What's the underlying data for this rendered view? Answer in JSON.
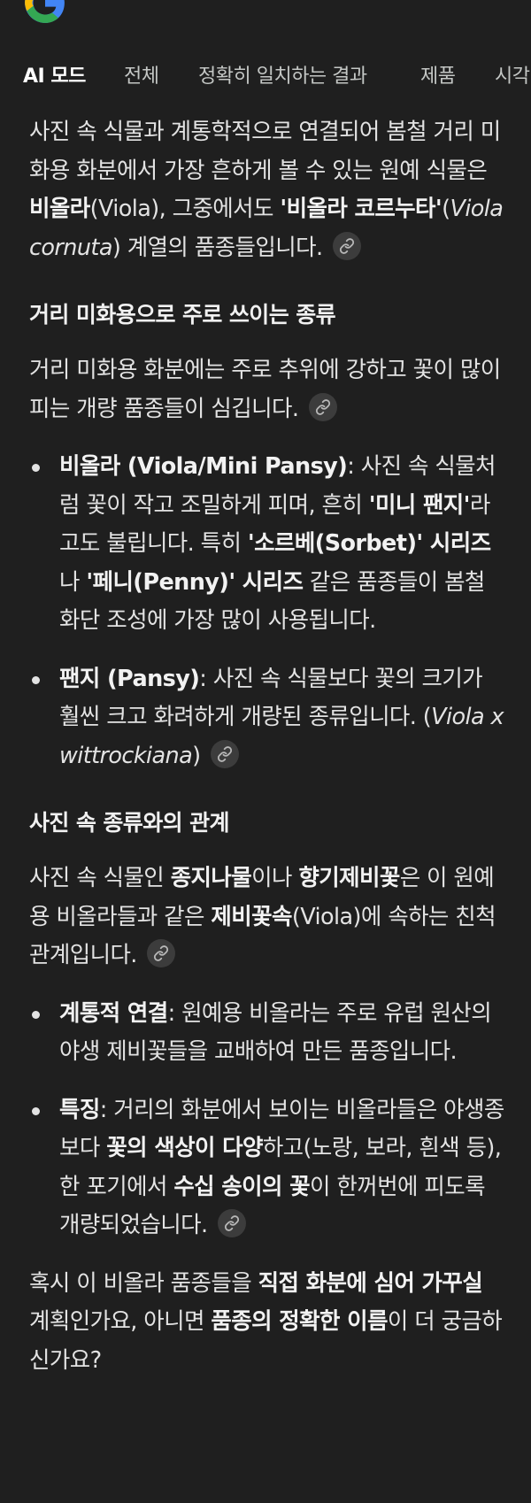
{
  "tabs": [
    "AI 모드",
    "전체",
    "정확히 일치하는 결과",
    "제품",
    "시각"
  ],
  "intro": {
    "t1": "사진 속 식물과 계통학적으로 연결되어 봄철 거리 미화용 화분에서 가장 흔하게 볼 수 있는 원예 식물은 ",
    "b1": "비올라",
    "t2": "(Viola), 그중에서도 ",
    "b2": "'비올라 코르누타'",
    "t3": "(",
    "i1": "Viola cornuta",
    "t4": ") 계열의 품종들입니다."
  },
  "section1": {
    "heading": "거리 미화용으로 주로 쓰이는 종류",
    "para": "거리 미화용 화분에는 주로 추위에 강하고 꽃이 많이 피는 개량 품종들이 심깁니다.",
    "bullets": [
      {
        "label": "비올라 (Viola/Mini Pansy)",
        "t1": ": 사진 속 식물처럼 꽃이 작고 조밀하게 피며, 흔히 ",
        "b1": "'미니 팬지'",
        "t2": "라고도 불립니다. 특히 ",
        "b2": "'소르베(Sorbet)' 시리즈",
        "t3": "나 ",
        "b3": "'페니(Penny)' 시리즈",
        "t4": " 같은 품종들이 봄철 화단 조성에 가장 많이 사용됩니다."
      },
      {
        "label": "팬지 (Pansy)",
        "t1": ": 사진 속 식물보다 꽃의 크기가 훨씬 크고 화려하게 개량된 종류입니다. (",
        "i1": "Viola x wittrockiana",
        "t2": ")"
      }
    ]
  },
  "section2": {
    "heading": "사진 속 종류와의 관계",
    "para": {
      "t1": "사진 속 식물인 ",
      "b1": "종지나물",
      "t2": "이나 ",
      "b2": "향기제비꽃",
      "t3": "은 이 원예용 비올라들과 같은 ",
      "b3": "제비꽃속",
      "t4": "(Viola)에 속하는 친척 관계입니다."
    },
    "bullets": [
      {
        "label": "계통적 연결",
        "t1": ": 원예용 비올라는 주로 유럽 원산의 야생 제비꽃들을 교배하여 만든 품종입니다."
      },
      {
        "label": "특징",
        "t1": ": 거리의 화분에서 보이는 비올라들은 야생종보다 ",
        "b1": "꽃의 색상이 다양",
        "t2": "하고(노랑, 보라, 흰색 등), 한 포기에서 ",
        "b2": "수십 송이의 꽃",
        "t3": "이 한꺼번에 피도록 개량되었습니다."
      }
    ]
  },
  "closing": {
    "t1": "혹시 이 비올라 품종들을 ",
    "b1": "직접 화분에 심어 가꾸실",
    "t2": " 계획인가요, 아니면 ",
    "b2": "품종의 정확한 이름",
    "t3": "이 더 궁금하신가요?"
  },
  "colors": {
    "background": "#1f1f1f",
    "text": "#e3e3e3",
    "link_chip": "#3c3c3c"
  }
}
